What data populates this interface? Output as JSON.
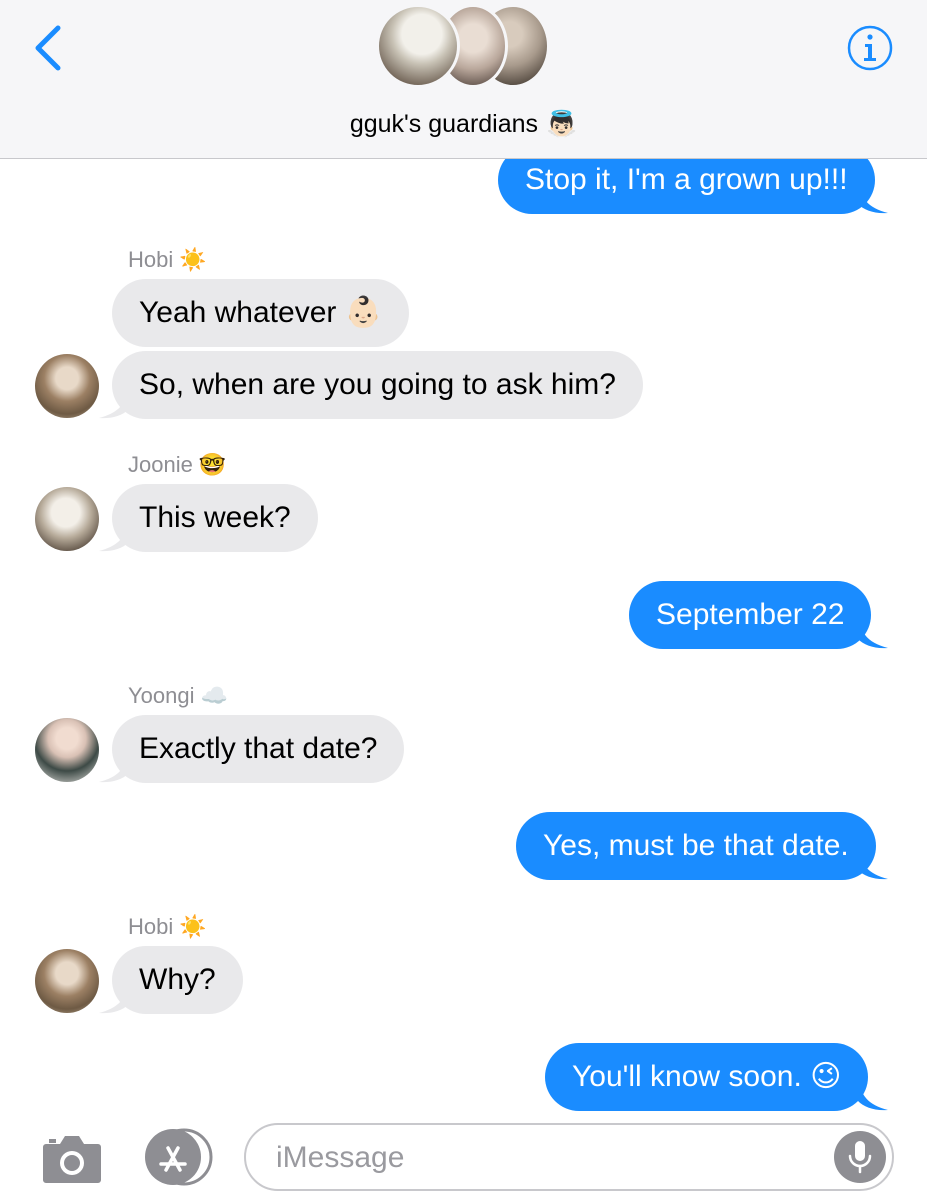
{
  "header": {
    "group_name": "gguk's guardians",
    "group_emoji": "👼🏻",
    "back_icon": "chevron-left-icon",
    "info_icon": "info-icon",
    "accent_color": "#1a8cff"
  },
  "messages": [
    {
      "direction": "outgoing",
      "text": "Stop it, I'm a grown up!!!"
    },
    {
      "direction": "incoming",
      "sender": "Hobi",
      "sender_emoji": "☀️",
      "text": "Yeah whatever 👶🏻"
    },
    {
      "direction": "incoming",
      "sender": "Hobi",
      "text": "So, when are you going to ask him?"
    },
    {
      "direction": "incoming",
      "sender": "Joonie",
      "sender_emoji": "🤓",
      "text": "This week?"
    },
    {
      "direction": "outgoing",
      "text": "September 22"
    },
    {
      "direction": "incoming",
      "sender": "Yoongi",
      "sender_emoji": "☁️",
      "text": "Exactly that date?"
    },
    {
      "direction": "outgoing",
      "text": "Yes, must be that date."
    },
    {
      "direction": "incoming",
      "sender": "Hobi",
      "sender_emoji": "☀️",
      "text": "Why?"
    },
    {
      "direction": "outgoing",
      "text": "You'll know soon. 😉"
    }
  ],
  "composer": {
    "placeholder": "iMessage",
    "camera_icon": "camera-icon",
    "apps_icon": "app-store-icon",
    "mic_icon": "microphone-icon"
  },
  "colors": {
    "outgoing_bubble": "#1a8cff",
    "incoming_bubble": "#e9e9eb",
    "sender_label": "#8e8e93"
  }
}
